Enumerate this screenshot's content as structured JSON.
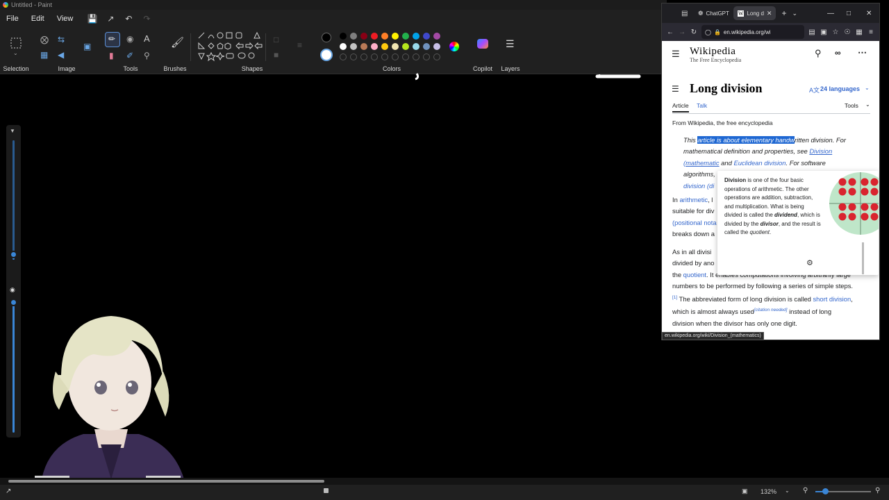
{
  "paint": {
    "window_title": "Untitled - Paint",
    "menu": [
      "File",
      "Edit",
      "View"
    ],
    "groups": {
      "selection": "Selection",
      "image": "Image",
      "tools": "Tools",
      "brushes": "Brushes",
      "shapes": "Shapes",
      "colors": "Colors",
      "copilot": "Copilot",
      "layers": "Layers"
    },
    "palette_row1": [
      "#000000",
      "#7f7f7f",
      "#880015",
      "#ed1c24",
      "#ff7f27",
      "#fff200",
      "#22b14c",
      "#00a2e8",
      "#3f48cc",
      "#a349a4"
    ],
    "palette_row2": [
      "#ffffff",
      "#c3c3c3",
      "#b97a57",
      "#ffaec9",
      "#ffc90e",
      "#efe4b0",
      "#b5e61d",
      "#99d9ea",
      "#7092be",
      "#c8bfe7"
    ],
    "zoom": "132%"
  },
  "browser": {
    "tabs": [
      {
        "label": "ChatGPT",
        "icon": "chatgpt-icon"
      },
      {
        "label": "Long d",
        "icon": "wikipedia-w-icon"
      }
    ],
    "url": "en.wikipedia.org/wi",
    "status_url": "en.wikipedia.org/wiki/Division_(mathematics)"
  },
  "wiki": {
    "logo": "Wikipedia",
    "tagline": "The Free Encyclopedia",
    "title": "Long division",
    "languages": "24 languages",
    "tab_article": "Article",
    "tab_talk": "Talk",
    "tools": "Tools",
    "from": "From Wikipedia, the free encyclopedia",
    "hatnote": {
      "pre": "This ",
      "highlight": "article is about elementary handw",
      "post1": "ritten division. For",
      "line2_pre": "mathematical definition and properties, see ",
      "link1a": "Division",
      "link1b": "(mathematic",
      "mid": " and ",
      "link2": "Euclidean division",
      "post2": ". For software",
      "line4": "algorithms,",
      "line5_link": "division (di"
    },
    "p1": {
      "pre": "In ",
      "link": "arithmetic",
      "post": ", l",
      "line2": "suitable for div",
      "line3_link": "(positional nota",
      "line4": "breaks down a"
    },
    "p2": {
      "line1": "As in all divisi",
      "line2": "divided by ano",
      "line3_pre": "the ",
      "line3_link": "quotient",
      "line3_post": ". It enables computations involving arbitrarily large",
      "line4": "numbers to be performed by following a series of simple steps.",
      "ref": "[1]",
      "line5_pre": " The abbreviated form of long division is called ",
      "line5_link": "short division",
      "line5_post": ",",
      "line6_pre": "which is almost always used",
      "cite": "[citation needed]",
      "line6_post": " instead of long",
      "line7": "division when the divisor has only one digit."
    },
    "popup": {
      "term": "Division",
      "t1": " is one of the four basic operations of arithmetic. The other operations are addition, subtraction, and multiplication. What is being divided is called the ",
      "dividend": "dividend",
      "t2": ", which is divided by the ",
      "divisor": "divisor",
      "t3": ", and the result is called the ",
      "quotient": "quotient",
      "t4": "."
    }
  }
}
